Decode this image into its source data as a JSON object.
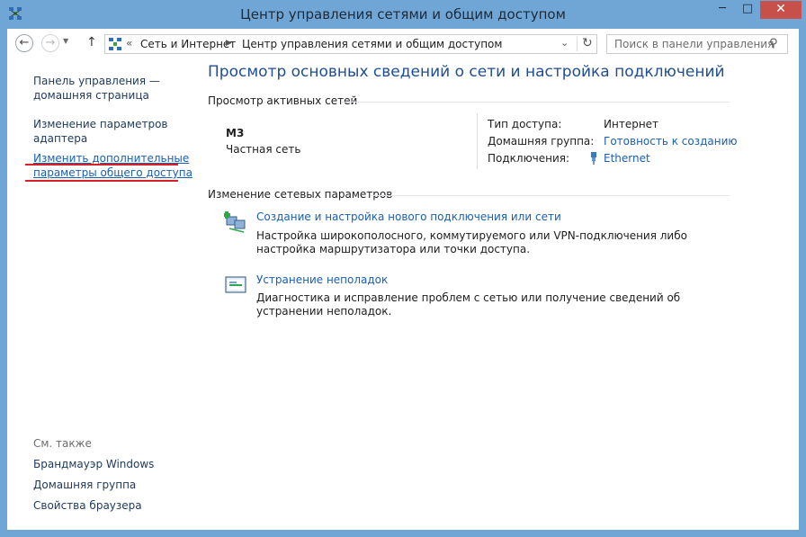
{
  "window": {
    "title": "Центр управления сетями и общим доступом",
    "minimize": "─",
    "maximize": "□",
    "close": "✕"
  },
  "nav": {
    "back_icon": "arrow-left-icon",
    "forward_icon": "arrow-right-icon",
    "up_icon": "arrow-up-icon",
    "breadcrumb_prefix": "«",
    "breadcrumbs": [
      "Сеть и Интернет",
      "Центр управления сетями и общим доступом"
    ],
    "search_placeholder": "Поиск в панели управления"
  },
  "sidebar": {
    "links": [
      "Панель управления —\nдомашняя страница",
      "Изменение параметров\nадаптера",
      "Изменить дополнительные\nпараметры общего доступа"
    ],
    "see_also_title": "См. также",
    "see_also": [
      "Брандмауэр Windows",
      "Домашняя группа",
      "Свойства браузера"
    ]
  },
  "main": {
    "title": "Просмотр основных сведений о сети и настройка подключений",
    "active_networks_header": "Просмотр активных сетей",
    "network": {
      "name": "M3",
      "type": "Частная сеть",
      "access_type_label": "Тип доступа:",
      "access_type_value": "Интернет",
      "homegroup_label": "Домашняя группа:",
      "homegroup_value": "Готовность к созданию",
      "connections_label": "Подключения:",
      "connections_value": "Ethernet"
    },
    "change_settings_header": "Изменение сетевых параметров",
    "tasks": [
      {
        "title": "Создание и настройка нового подключения или сети",
        "description": "Настройка широкополосного, коммутируемого или VPN-подключения либо настройка маршрутизатора или точки доступа."
      },
      {
        "title": "Устранение неполадок",
        "description": "Диагностика и исправление проблем с сетью или получение сведений об устранении неполадок."
      }
    ]
  },
  "colors": {
    "titlebar": "#6fa6d6",
    "link": "#1a5fb4",
    "title_blue": "#1f4e96",
    "highlight_red": "#d6202a",
    "close_button": "#c7504b"
  }
}
